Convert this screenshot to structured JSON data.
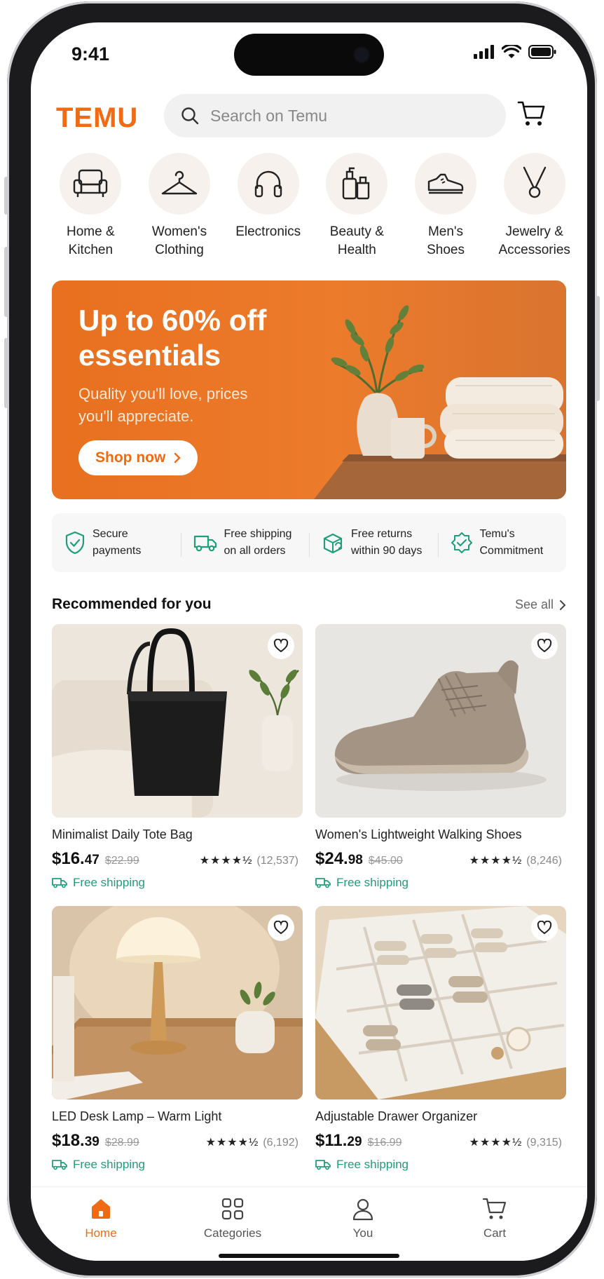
{
  "status_bar": {
    "time": "9:41"
  },
  "header": {
    "logo": "TEMU",
    "search_placeholder": "Search on Temu"
  },
  "categories": [
    {
      "label": "Home &\nKitchen",
      "icon": "armchair-icon"
    },
    {
      "label": "Women's\nClothing",
      "icon": "hanger-icon"
    },
    {
      "label": "Electronics",
      "icon": "headphones-icon"
    },
    {
      "label": "Beauty &\nHealth",
      "icon": "bottles-icon"
    },
    {
      "label": "Men's\nShoes",
      "icon": "sneaker-icon"
    },
    {
      "label": "Jewelry &\nAccessories",
      "icon": "necklace-icon"
    }
  ],
  "banner": {
    "title": "Up to 60% off essentials",
    "subtitle": "Quality you'll love, prices you'll appreciate.",
    "cta": "Shop now",
    "accent": "#EE6B12"
  },
  "trust": [
    {
      "label": "Secure\npayments",
      "icon": "shield-check-icon"
    },
    {
      "label": "Free shipping\non all orders",
      "icon": "truck-icon"
    },
    {
      "label": "Free returns\nwithin 90 days",
      "icon": "return-box-icon"
    },
    {
      "label": "Temu's\nCommitment",
      "icon": "badge-check-icon"
    }
  ],
  "recommended": {
    "title": "Recommended for you",
    "see_all": "See all"
  },
  "products": [
    {
      "name": "Minimalist Daily Tote Bag",
      "price_main": "$16.",
      "price_cents": "47",
      "old_price": "$22.99",
      "stars": "★★★★½",
      "rating": 4.5,
      "reviews": "(12,537)",
      "shipping": "Free shipping"
    },
    {
      "name": "Women's Lightweight Walking Shoes",
      "price_main": "$24.",
      "price_cents": "98",
      "old_price": "$45.00",
      "stars": "★★★★½",
      "rating": 4.5,
      "reviews": "(8,246)",
      "shipping": "Free shipping"
    },
    {
      "name": "LED Desk Lamp – Warm Light",
      "price_main": "$18.",
      "price_cents": "39",
      "old_price": "$28.99",
      "stars": "★★★★½",
      "rating": 4.5,
      "reviews": "(6,192)",
      "shipping": "Free shipping"
    },
    {
      "name": "Adjustable Drawer Organizer",
      "price_main": "$11.",
      "price_cents": "29",
      "old_price": "$16.99",
      "stars": "★★★★½",
      "rating": 4.5,
      "reviews": "(9,315)",
      "shipping": "Free shipping"
    }
  ],
  "tabbar": {
    "home": "Home",
    "categories": "Categories",
    "you": "You",
    "cart": "Cart"
  },
  "colors": {
    "brand": "#F26A13",
    "shipping": "#1F9E7A"
  }
}
